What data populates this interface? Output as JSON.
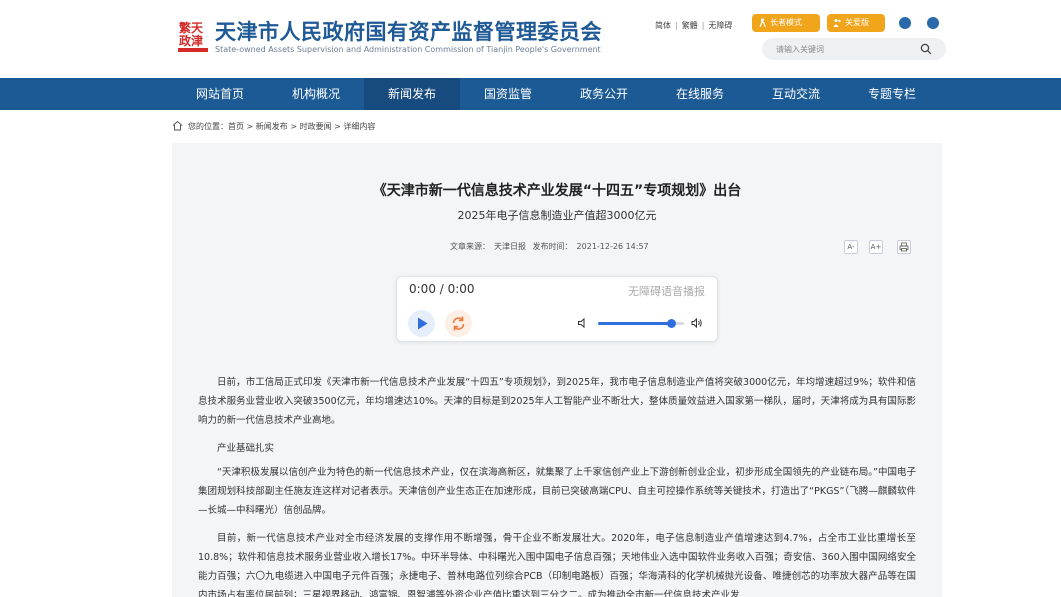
{
  "header": {
    "title": "天津市人民政府国有资产监督管理委员会",
    "subtitle": "State-owned Assets Supervision and Administration Commission of Tianjin People's Government",
    "logo_icon": "tianjin-emblem-logo",
    "links": [
      "简体",
      "繁體",
      "无障碍"
    ],
    "elder_mode": "长者模式",
    "care_mode": "关爱版",
    "search_placeholder": "请输入关键词",
    "accent": "#1c5a96",
    "button_color": "#f0a51b"
  },
  "nav": {
    "items": [
      "网站首页",
      "机构概况",
      "新闻发布",
      "国资监管",
      "政务公开",
      "在线服务",
      "互动交流",
      "专题专栏"
    ],
    "active_index": 2
  },
  "breadcrumb": {
    "label": "您的位置：",
    "items": [
      "首页",
      "新闻发布",
      "时政要闻",
      "详细内容"
    ],
    "separator": " > "
  },
  "article": {
    "title": "《天津市新一代信息技术产业发展“十四五”专项规划》出台",
    "subtitle": "2025年电子信息制造业产值超3000亿元",
    "source_label": "文章来源：",
    "source": "天津日报",
    "time_label": "发布时间：",
    "time": "2021-12-26 14:57",
    "tools": [
      "A-",
      "A+",
      "print"
    ],
    "paragraphs": [
      "日前，市工信局正式印发《天津市新一代信息技术产业发展“十四五”专项规划》，到2025年，我市电子信息制造业产值将突破3000亿元，年均增速超过9%；软件和信息技术服务业营业收入突破3500亿元，年均增速达10%。天津的目标是到2025年人工智能产业不断壮大，整体质量效益进入国家第一梯队，届时，天津将成为具有国际影响力的新一代信息技术产业高地。",
      "产业基础扎实",
      "“天津积极发展以信创产业为特色的新一代信息技术产业，仅在滨海高新区，就集聚了上千家信创产业上下游创新创业企业，初步形成全国领先的产业链布局。”中国电子集团规划科技部副主任施友连这样对记者表示。天津信创产业生态正在加速形成，目前已突破高端CPU、自主可控操作系统等关键技术，打造出了“PKGS”（飞腾—麒麟软件—长城—中科曙光）信创品牌。",
      "目前，新一代信息技术产业对全市经济发展的支撑作用不断增强，骨干企业不断发展壮大。2020年，电子信息制造业产值增速达到4.7%，占全市工业比重增长至10.8%；软件和信息技术服务业营业收入增长17%。中环半导体、中科曙光入围中国电子信息百强；天地伟业入选中国软件业务收入百强；奇安信、360入围中国网络安全能力百强；六〇九电缆进入中国电子元件百强；永捷电子、普林电路位列综合PCB（印制电路板）百强；华海清科的化学机械抛光设备、唯捷创芯的功率放大器产品等在国内市场占有率位居前列；三星视界移动、鸿富锦、恩智浦等外资企业产值比重达到三分之二。成为推动全市新一代信息技术产业发"
    ]
  },
  "player": {
    "time": "0:00 / 0:00",
    "label": "无障碍语音播报",
    "volume": 0.85
  }
}
